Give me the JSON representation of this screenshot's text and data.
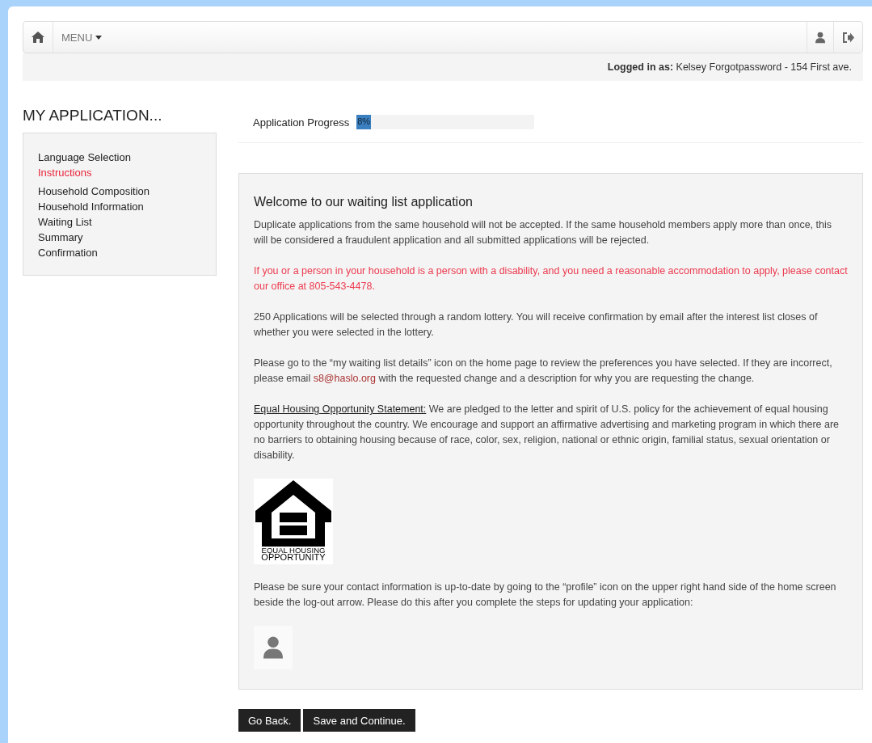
{
  "navbar": {
    "menu_label": "MENU"
  },
  "login_bar": {
    "label": "Logged in as:",
    "value": "Kelsey Forgotpassword - 154 First ave."
  },
  "sidebar": {
    "title": "MY APPLICATION...",
    "items": [
      {
        "label": "Language Selection",
        "selected": false
      },
      {
        "label": "Instructions",
        "selected": true
      },
      {
        "label": "Household Composition",
        "selected": false
      },
      {
        "label": "Household Information",
        "selected": false
      },
      {
        "label": "Waiting List",
        "selected": false
      },
      {
        "label": "Summary",
        "selected": false
      },
      {
        "label": "Confirmation",
        "selected": false
      }
    ]
  },
  "progress": {
    "label": "Application Progress",
    "reading": "8%",
    "level": 0.08
  },
  "content": {
    "heading": "Welcome to our waiting list application",
    "blocks": [
      {
        "kind": "text",
        "text": "Duplicate applications from the same household will not be accepted. If the same household members apply more than once, this will be considered a fraudulent application and all submitted applications will be rejected."
      },
      {
        "kind": "alert",
        "text": "If you or a person in your household is a person with a disability, and you need a reasonable accommodation to apply, please contact our office at 805-543-4478."
      },
      {
        "kind": "text",
        "text": "250 Applications will be selected through a random lottery. You will receive confirmation by email after the interest list closes of whether you were selected in the lottery."
      },
      {
        "kind": "link",
        "before": "Please go to the “my waiting list details” icon on the home page to review the preferences you have selected. If they are incorrect, please email ",
        "link": "s8@haslo.org",
        "after": " with the requested change and a description for why you are requesting the change."
      },
      {
        "kind": "statement",
        "label": "Equal Housing Opportunity Statement:",
        "text": " We are pledged to the letter and spirit of U.S. policy for the achievement of equal housing opportunity throughout the country. We encourage and support an affirmative advertising and marketing program in which there are no barriers to obtaining housing because of race, color, sex, religion, national or ethnic origin, familial status, sexual orientation or disability."
      },
      {
        "kind": "logo",
        "lines": [
          "EQUAL HOUSING",
          "OPPORTUNITY"
        ]
      },
      {
        "kind": "text",
        "text": "Please be sure your contact information is up-to-date by going to the “profile” icon on the upper right hand side of the home screen beside the log-out arrow. Please do this after you complete the steps for updating your application:"
      },
      {
        "kind": "profile"
      }
    ]
  },
  "buttons": [
    "Go Back.",
    "Save and Continue."
  ]
}
